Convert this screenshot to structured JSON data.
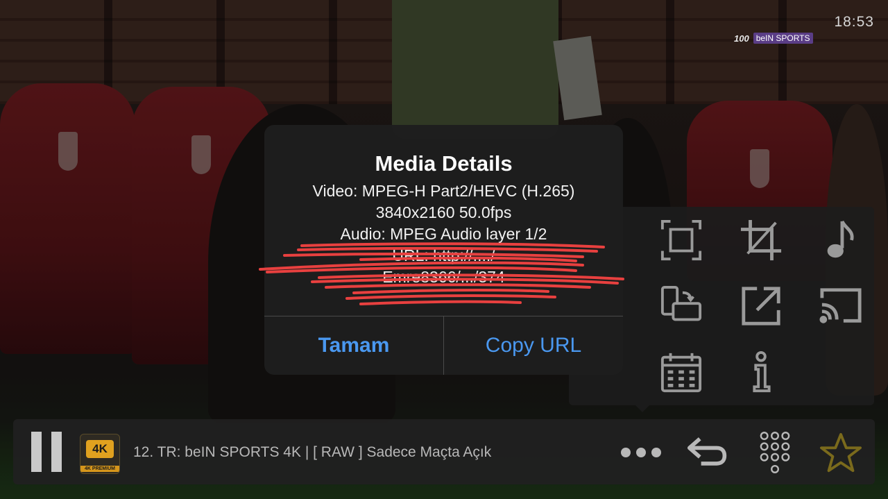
{
  "status": {
    "time": "18:53"
  },
  "overlay_logo": {
    "prefix": "100",
    "brand": "beIN SPORTS"
  },
  "modal": {
    "title": "Media Details",
    "lines": [
      "Video: MPEG-H Part2/HEVC (H.265)",
      "3840x2160 50.0fps",
      "Audio: MPEG Audio layer 1/2",
      "URL: http://..../",
      "Emre8366/.../374"
    ],
    "ok_label": "Tamam",
    "copy_label": "Copy URL",
    "button_color": "#4a98f0"
  },
  "actions": [
    {
      "icon": "fullscreen-icon"
    },
    {
      "icon": "crop-icon"
    },
    {
      "icon": "audio-track-icon"
    },
    {
      "icon": "rotate-screen-icon"
    },
    {
      "icon": "external-open-icon"
    },
    {
      "icon": "cast-icon"
    },
    {
      "icon": "calendar-icon"
    },
    {
      "icon": "info-icon"
    }
  ],
  "player": {
    "channel_badge": "4K",
    "channel_badge_sub": "4K PREMIUM",
    "channel_title": "12. TR: beIN SPORTS 4K | [ RAW ] Sadece Maçta Açık",
    "star_color": "#7a6a1c"
  }
}
